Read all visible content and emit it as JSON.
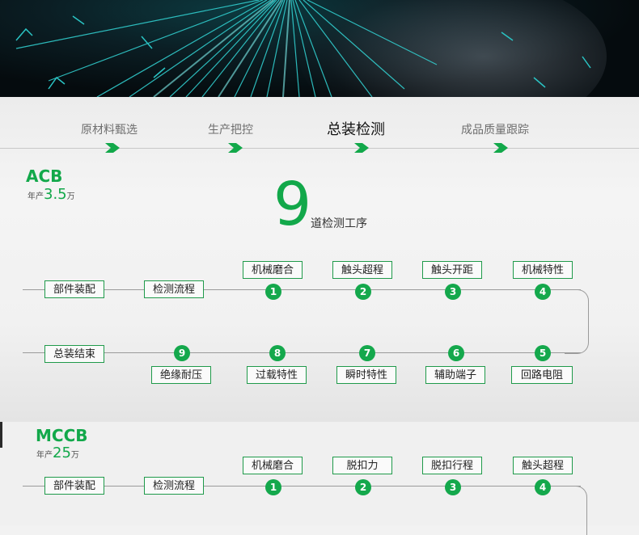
{
  "process_steps": [
    {
      "label": "原材料甄选",
      "active": false
    },
    {
      "label": "生产把控",
      "active": false
    },
    {
      "label": "总装检测",
      "active": true
    },
    {
      "label": "成品质量跟踪",
      "active": false
    }
  ],
  "acb": {
    "name": "ACB",
    "output_prefix": "年产",
    "output_value": "3.5",
    "output_unit": "万",
    "procedure_count": "9",
    "procedure_label": "道检测工序",
    "start_label": "部件装配",
    "flow_label": "检测流程",
    "end_label": "总装结束",
    "steps": [
      {
        "num": "1",
        "label": "机械磨合"
      },
      {
        "num": "2",
        "label": "触头超程"
      },
      {
        "num": "3",
        "label": "触头开距"
      },
      {
        "num": "4",
        "label": "机械特性"
      },
      {
        "num": "5",
        "label": "回路电阻"
      },
      {
        "num": "6",
        "label": "辅助端子"
      },
      {
        "num": "7",
        "label": "瞬时特性"
      },
      {
        "num": "8",
        "label": "过载特性"
      },
      {
        "num": "9",
        "label": "绝缘耐压"
      }
    ]
  },
  "mccb": {
    "name": "MCCB",
    "output_prefix": "年产",
    "output_value": "25",
    "output_unit": "万",
    "start_label": "部件装配",
    "flow_label": "检测流程",
    "steps": [
      {
        "num": "1",
        "label": "机械磨合"
      },
      {
        "num": "2",
        "label": "脱扣力"
      },
      {
        "num": "3",
        "label": "脱扣行程"
      },
      {
        "num": "4",
        "label": "触头超程"
      }
    ]
  },
  "colors": {
    "accent": "#12a84a",
    "hero_bg": "#050b0e"
  }
}
